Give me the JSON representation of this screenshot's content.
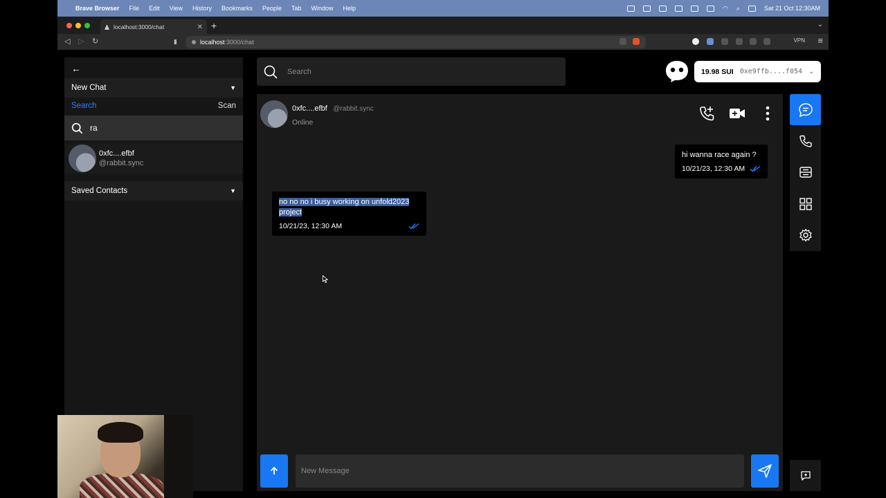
{
  "menubar": {
    "app_name": "Brave Browser",
    "items": [
      "File",
      "Edit",
      "View",
      "History",
      "Bookmarks",
      "People",
      "Tab",
      "Window",
      "Help"
    ],
    "datetime": "Sat 21 Oct  12:30AM"
  },
  "browser": {
    "tab_title": "localhost:3000/chat",
    "url_host": "localhost",
    "url_path": ":3000/chat",
    "vpn_label": "VPN"
  },
  "sidebar": {
    "new_chat_label": "New Chat",
    "tabs": {
      "search": "Search",
      "scan": "Scan"
    },
    "search_value": "ra",
    "result": {
      "name": "0xfc....efbf",
      "username": "@rabbit.sync"
    },
    "saved_contacts_label": "Saved Contacts"
  },
  "header": {
    "search_placeholder": "Search",
    "wallet": {
      "balance": "19.98 SUI",
      "address": "0xe9ffb....f054"
    }
  },
  "chat": {
    "contact": {
      "name": "0xfc....efbf",
      "username": "@rabbit.sync",
      "status": "Online"
    },
    "messages": [
      {
        "direction": "outgoing",
        "text": "hi wanna race again ?",
        "time": "10/21/23, 12:30 AM"
      },
      {
        "direction": "incoming",
        "text": "no no no i busy working on unfold2023 project",
        "time": "10/21/23, 12:30 AM"
      }
    ],
    "composer_placeholder": "New Message"
  },
  "icons": {
    "back": "arrow-left-icon",
    "search": "search-icon",
    "chevron": "chevron-down-icon",
    "call_add": "phone-plus-icon",
    "video": "video-camera-icon",
    "more": "more-vertical-icon",
    "nav": [
      "chat-bubble-icon",
      "phone-icon",
      "card-icon",
      "grid-icon",
      "gear-icon"
    ],
    "new_chat": "message-plus-icon",
    "attach": "arrow-up-icon",
    "send": "paper-plane-icon"
  },
  "colors": {
    "accent": "#1877f2",
    "active_tab": "#2f7dff",
    "selection": "#3d5e9c"
  }
}
